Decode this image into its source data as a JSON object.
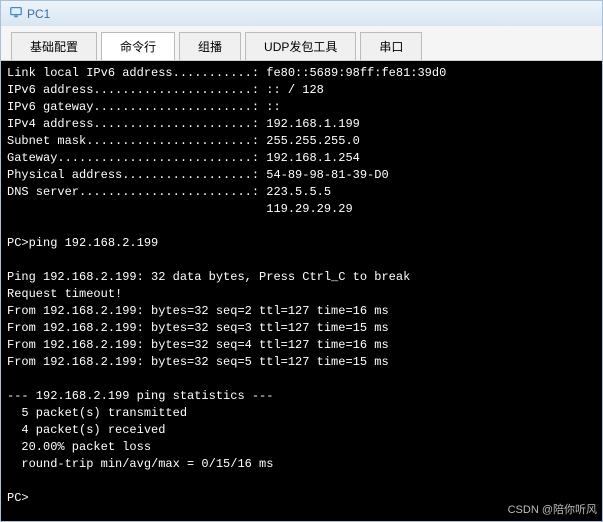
{
  "title": "PC1",
  "tabs": [
    {
      "label": "基础配置",
      "active": false
    },
    {
      "label": "命令行",
      "active": true
    },
    {
      "label": "组播",
      "active": false
    },
    {
      "label": "UDP发包工具",
      "active": false
    },
    {
      "label": "串口",
      "active": false
    }
  ],
  "terminal": {
    "lines": [
      "Link local IPv6 address...........: fe80::5689:98ff:fe81:39d0",
      "IPv6 address......................: :: / 128",
      "IPv6 gateway......................: ::",
      "IPv4 address......................: 192.168.1.199",
      "Subnet mask.......................: 255.255.255.0",
      "Gateway...........................: 192.168.1.254",
      "Physical address..................: 54-89-98-81-39-D0",
      "DNS server........................: 223.5.5.5",
      "                                    119.29.29.29",
      "",
      "PC>ping 192.168.2.199",
      "",
      "Ping 192.168.2.199: 32 data bytes, Press Ctrl_C to break",
      "Request timeout!",
      "From 192.168.2.199: bytes=32 seq=2 ttl=127 time=16 ms",
      "From 192.168.2.199: bytes=32 seq=3 ttl=127 time=15 ms",
      "From 192.168.2.199: bytes=32 seq=4 ttl=127 time=16 ms",
      "From 192.168.2.199: bytes=32 seq=5 ttl=127 time=15 ms",
      "",
      "--- 192.168.2.199 ping statistics ---",
      "  5 packet(s) transmitted",
      "  4 packet(s) received",
      "  20.00% packet loss",
      "  round-trip min/avg/max = 0/15/16 ms",
      "",
      "PC>"
    ]
  },
  "watermark": "CSDN @陪你听风"
}
